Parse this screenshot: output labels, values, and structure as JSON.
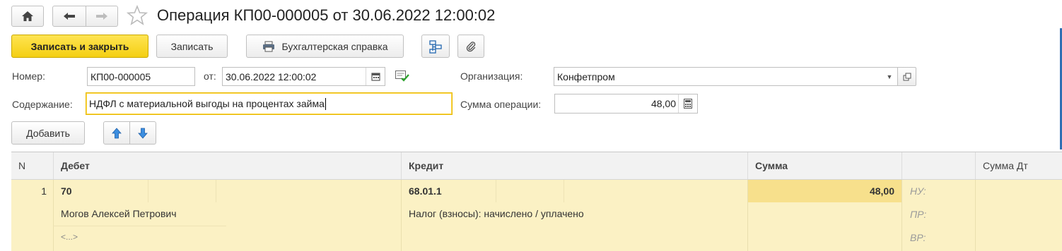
{
  "window": {
    "title": "Операция КП00-000005 от 30.06.2022 12:00:02"
  },
  "toolbar": {
    "save_close_label": "Записать и закрыть",
    "save_label": "Записать",
    "report_label": "Бухгалтерская справка"
  },
  "form": {
    "number_label": "Номер:",
    "number_value": "КП00-000005",
    "date_label": "от:",
    "date_value": "30.06.2022 12:00:02",
    "org_label": "Организация:",
    "org_value": "Конфетпром",
    "content_label": "Содержание:",
    "content_value": "НДФЛ с материальной выгоды на процентах займа",
    "sum_label": "Сумма операции:",
    "sum_value": "48,00"
  },
  "table_toolbar": {
    "add_label": "Добавить"
  },
  "table": {
    "columns": [
      "N",
      "Дебет",
      "Кредит",
      "Сумма",
      "",
      "Сумма Дт"
    ],
    "rows": [
      {
        "n": "1",
        "debit_account": "70",
        "debit_sub1": "Могов Алексей Петрович",
        "debit_sub2": "<...>",
        "credit_account": "68.01.1",
        "credit_sub1": "Налог (взносы): начислено / уплачено",
        "sum": "48,00",
        "nu": "НУ:",
        "pr": "ПР:",
        "vr": "ВР:"
      }
    ]
  },
  "colors": {
    "primary_button": "#f4cf12",
    "row_bg": "#fbf1c4",
    "sum_cell_bg": "#f7e08c",
    "focus_border": "#e6b800"
  }
}
